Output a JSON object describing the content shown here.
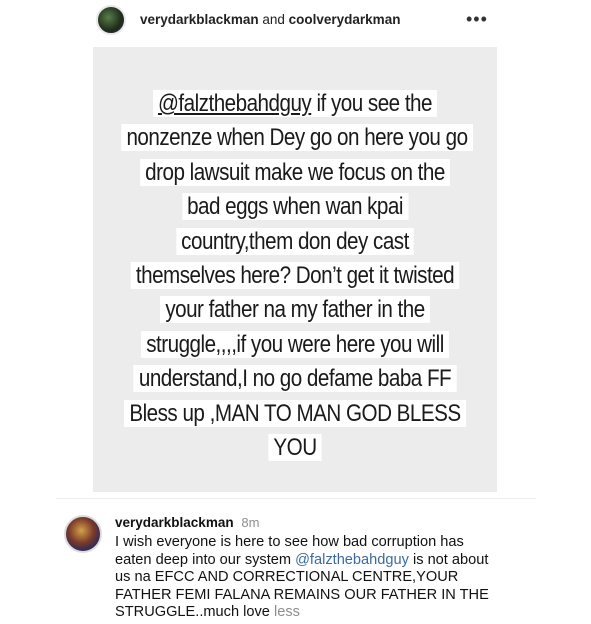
{
  "header": {
    "user1": "verydarkblackman",
    "joiner": "and",
    "user2": "coolverydarkman",
    "more_icon": "•••"
  },
  "story": {
    "lines": [
      {
        "text": "@falzthebahdguy",
        "rest": " if you see the"
      },
      {
        "text": "nonzenze when Dey go on here you go"
      },
      {
        "text": "drop lawsuit make we focus on the"
      },
      {
        "text": "bad eggs when wan kpai"
      },
      {
        "text": "country,them don dey cast"
      },
      {
        "text": "themselves here? Don’t get it twisted"
      },
      {
        "text": "your father na my father in the"
      },
      {
        "text": "struggle,,,,if you were here you will"
      },
      {
        "text": "understand,I no go defame baba FF"
      },
      {
        "text": "Bless up ,MAN TO MAN GOD BLESS"
      },
      {
        "text": "YOU"
      }
    ]
  },
  "comment": {
    "username": "verydarkblackman",
    "time": "8m",
    "text_before": "I wish everyone is here to see how bad corruption has eaten deep into our system ",
    "mention": "@falzthebahdguy",
    "text_after": " is not about us na EFCC AND CORRECTIONAL CENTRE,YOUR FATHER FEMI FALANA REMAINS OUR FATHER IN THE STRUGGLE..much love ",
    "less": "less"
  },
  "colors": {
    "story_bg": "#ececec",
    "mention_link": "#3b6aa0",
    "muted": "#8e8e8e"
  }
}
